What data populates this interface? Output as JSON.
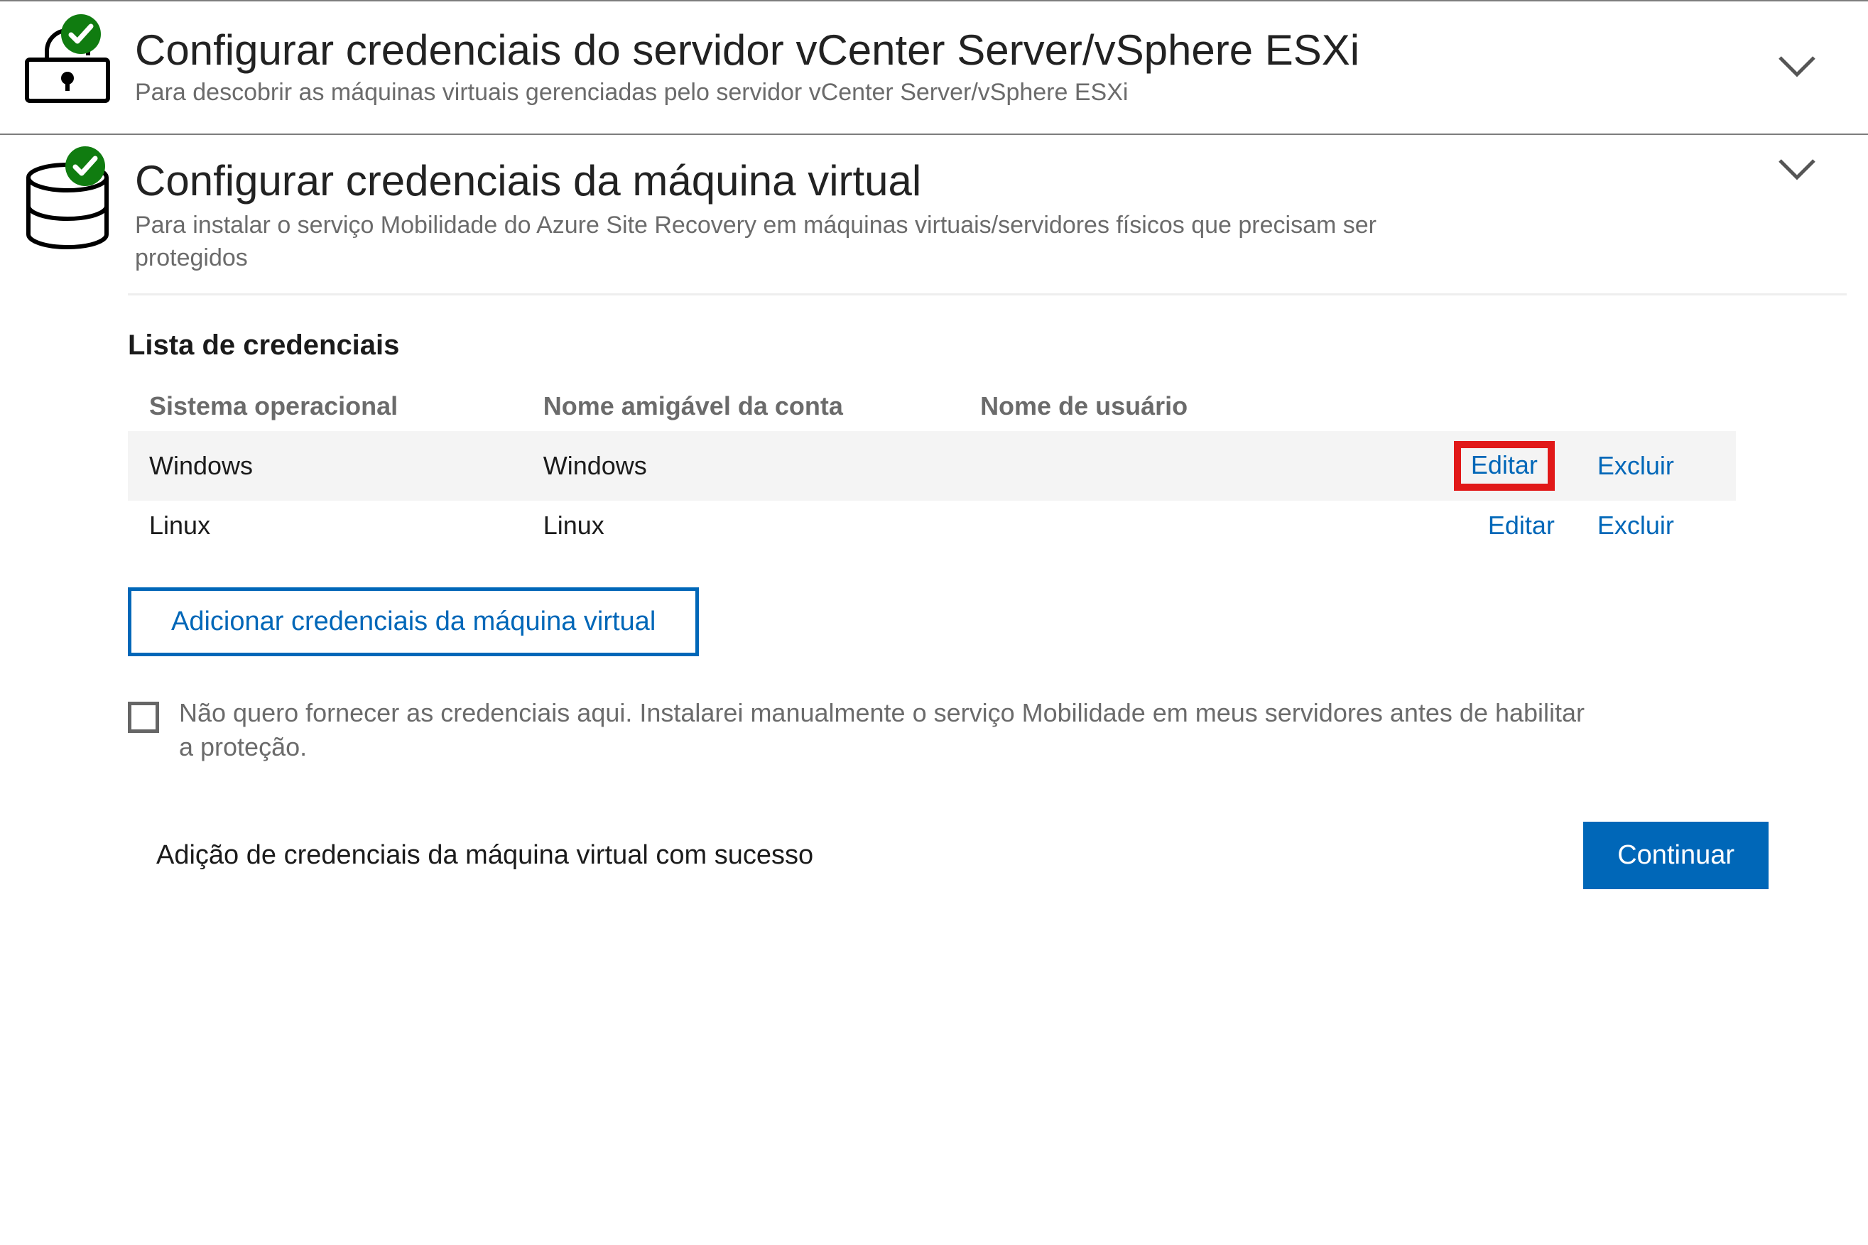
{
  "section1": {
    "title": "Configurar credenciais do servidor vCenter Server/vSphere ESXi",
    "subtitle": "Para descobrir as máquinas virtuais gerenciadas pelo servidor vCenter Server/vSphere ESXi"
  },
  "section2": {
    "title": "Configurar credenciais da máquina virtual",
    "subtitle": "Para instalar o serviço Mobilidade do Azure Site Recovery em máquinas virtuais/servidores físicos que precisam ser protegidos",
    "list_title": "Lista de credenciais",
    "columns": {
      "os": "Sistema operacional",
      "friendly_name": "Nome amigável da conta",
      "username": "Nome de usuário"
    },
    "rows": [
      {
        "os": "Windows",
        "friendly": "Windows",
        "user": "",
        "edit": "Editar",
        "del": "Excluir"
      },
      {
        "os": "Linux",
        "friendly": "Linux",
        "user": "",
        "edit": "Editar",
        "del": "Excluir"
      }
    ],
    "add_button": "Adicionar credenciais da máquina virtual",
    "skip_checkbox": "Não quero fornecer as credenciais aqui. Instalarei manualmente o serviço Mobilidade em meus servidores antes de habilitar a proteção.",
    "status_msg": "Adição de credenciais da máquina virtual com sucesso",
    "continue_label": "Continuar"
  },
  "icons": {
    "lock": "lock-icon",
    "db": "database-icon",
    "ok": "success-check-icon",
    "chevron": "chevron-down-icon"
  }
}
